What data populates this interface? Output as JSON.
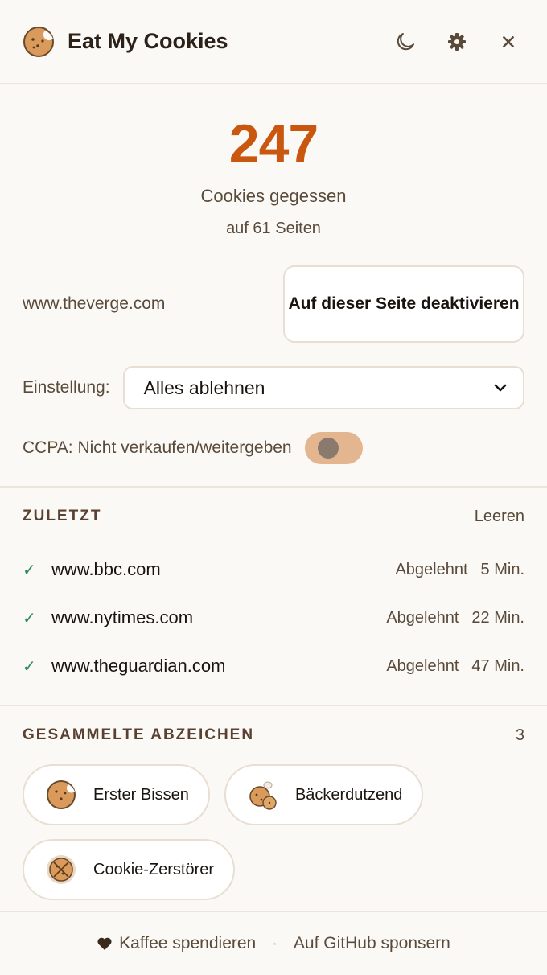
{
  "header": {
    "title": "Eat My Cookies",
    "icons": [
      "cookie-logo-icon",
      "moon-icon",
      "gear-icon",
      "close-icon"
    ]
  },
  "stats": {
    "count": "247",
    "count_label": "Cookies gegessen",
    "pages_label": "auf 61 Seiten"
  },
  "site": {
    "domain": "www.theverge.com",
    "disable_label": "Auf dieser Seite deaktivieren"
  },
  "setting": {
    "label": "Einstellung:",
    "selected": "Alles ablehnen"
  },
  "ccpa": {
    "label": "CCPA: Nicht verkaufen/weitergeben",
    "enabled": false
  },
  "recent": {
    "title": "ZULETZT",
    "clear_label": "Leeren",
    "items": [
      {
        "domain": "www.bbc.com",
        "status": "Abgelehnt",
        "time": "5 Min."
      },
      {
        "domain": "www.nytimes.com",
        "status": "Abgelehnt",
        "time": "22 Min."
      },
      {
        "domain": "www.theguardian.com",
        "status": "Abgelehnt",
        "time": "47 Min."
      }
    ]
  },
  "badges": {
    "title": "GESAMMELTE ABZEICHEN",
    "count": "3",
    "items": [
      {
        "label": "Erster Bissen",
        "icon": "cookie-bite-icon"
      },
      {
        "label": "Bäckerdutzend",
        "icon": "cookie-stack-icon"
      },
      {
        "label": "Cookie-Zerstörer",
        "icon": "cookie-crossed-icon"
      }
    ]
  },
  "footer": {
    "coffee_label": "Kaffee spendieren",
    "github_label": "Auf GitHub sponsern",
    "separator": "·"
  },
  "colors": {
    "accent": "#c9570f",
    "toggle_off": "#e3b690",
    "check": "#2e8b57",
    "background": "#faf9f6"
  }
}
